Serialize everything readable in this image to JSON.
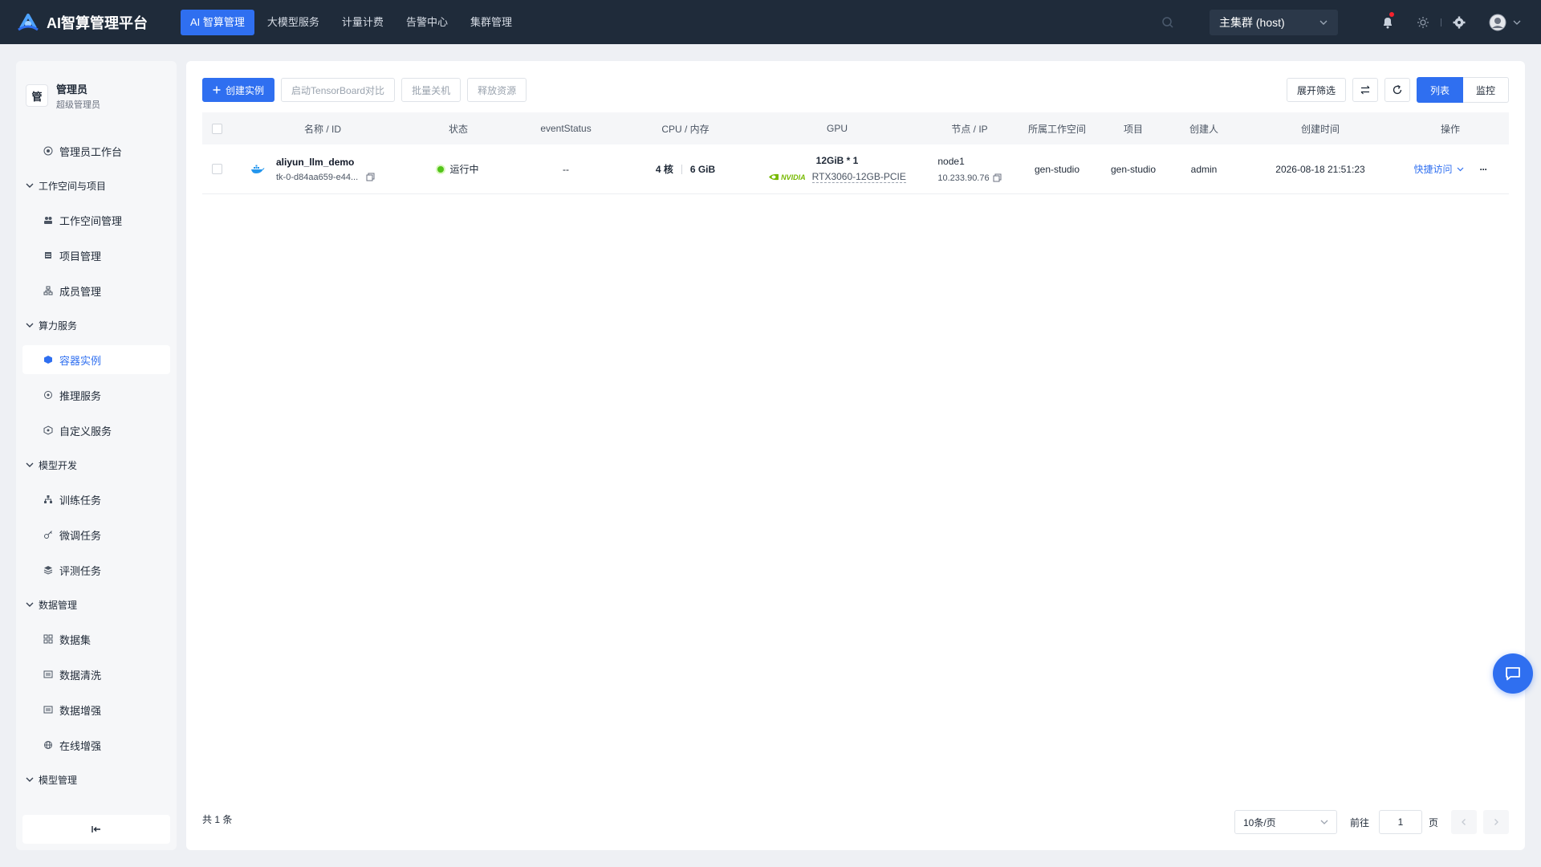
{
  "app": {
    "title": "AI智算管理平台"
  },
  "nav": {
    "items": [
      "AI 智算管理",
      "大模型服务",
      "计量计费",
      "告警中心",
      "集群管理"
    ],
    "active_index": 0
  },
  "cluster": {
    "label": "主集群 (host)"
  },
  "user": {
    "avatar_char": "管",
    "name": "管理员",
    "role": "超级管理员"
  },
  "sidebar": {
    "workbench": "管理员工作台",
    "groups": [
      {
        "title": "工作空间与项目",
        "items": [
          "工作空间管理",
          "项目管理",
          "成员管理"
        ]
      },
      {
        "title": "算力服务",
        "items": [
          "容器实例",
          "推理服务",
          "自定义服务"
        ]
      },
      {
        "title": "模型开发",
        "items": [
          "训练任务",
          "微调任务",
          "评测任务"
        ]
      },
      {
        "title": "数据管理",
        "items": [
          "数据集",
          "数据清洗",
          "数据增强",
          "在线增强"
        ]
      },
      {
        "title": "模型管理",
        "items": []
      }
    ],
    "active_item": "容器实例"
  },
  "toolbar": {
    "create": "创建实例",
    "tensorboard": "启动TensorBoard对比",
    "batch_shutdown": "批量关机",
    "release": "释放资源",
    "expand_filter": "展开筛选",
    "view_list": "列表",
    "view_monitor": "监控"
  },
  "table": {
    "columns": [
      "名称 / ID",
      "状态",
      "eventStatus",
      "CPU / 内存",
      "GPU",
      "节点 / IP",
      "所属工作空间",
      "项目",
      "创建人",
      "创建时间",
      "操作"
    ],
    "rows": [
      {
        "name": "aliyun_llm_demo",
        "id": "tk-0-d84aa659-e44...",
        "status": "运行中",
        "event_status": "--",
        "cpu": "4 核",
        "memory": "6 GiB",
        "gpu_spec": "12GiB * 1",
        "gpu_vendor": "NVIDIA",
        "gpu_model": "RTX3060-12GB-PCIE",
        "node": "node1",
        "ip": "10.233.90.76",
        "workspace": "gen-studio",
        "project": "gen-studio",
        "creator": "admin",
        "created_at": "2026-08-18 21:51:23",
        "quick_access": "快捷访问",
        "more": "···"
      }
    ]
  },
  "footer": {
    "total": "共 1 条",
    "page_size": "10条/页",
    "goto_prefix": "前往",
    "page_value": "1",
    "goto_suffix": "页"
  },
  "colors": {
    "primary": "#2f6ff0",
    "topbar": "#1f2b3a",
    "running": "#52c41a",
    "nvidia": "#76b900"
  }
}
